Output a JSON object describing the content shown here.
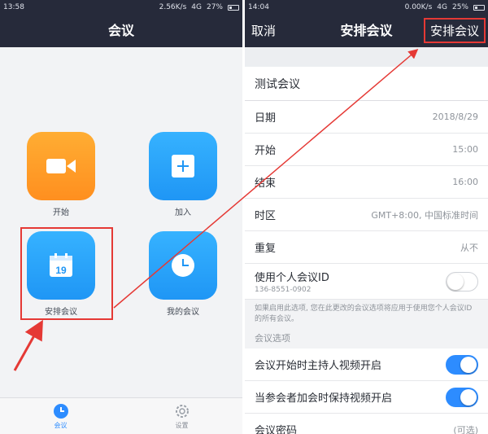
{
  "left": {
    "status": {
      "time": "13:58",
      "speed": "2.56K/s",
      "network": "4G",
      "battery": "27%"
    },
    "header": {
      "title": "会议"
    },
    "tiles": [
      {
        "label": "开始"
      },
      {
        "label": "加入"
      },
      {
        "label": "安排会议"
      },
      {
        "label": "我的会议"
      }
    ],
    "calendar_day": "19",
    "tabbar": [
      {
        "label": "会议"
      },
      {
        "label": "设置"
      }
    ]
  },
  "right": {
    "status": {
      "time": "14:04",
      "speed": "0.00K/s",
      "network": "4G",
      "battery": "25%"
    },
    "header": {
      "cancel": "取消",
      "title": "安排会议",
      "action": "安排会议"
    },
    "meeting_title": "测试会议",
    "rows": {
      "date": {
        "label": "日期",
        "value": "2018/8/29"
      },
      "start": {
        "label": "开始",
        "value": "15:00"
      },
      "end": {
        "label": "结束",
        "value": "16:00"
      },
      "timezone": {
        "label": "时区",
        "value": "GMT+8:00, 中国标准时间"
      },
      "repeat": {
        "label": "重复",
        "value": "从不"
      }
    },
    "pmi": {
      "label": "使用个人会议ID",
      "id": "136-8551-0902",
      "enabled": false
    },
    "pmi_note": "如果启用此选项, 您在此更改的会议选项将应用于使用您个人会议ID的所有会议。",
    "options_title": "会议选项",
    "options": [
      {
        "label": "会议开始时主持人视频开启",
        "enabled": true
      },
      {
        "label": "当参会者加会时保持视频开启",
        "enabled": true
      }
    ],
    "password": {
      "label": "会议密码",
      "value": "(可选)"
    }
  },
  "colors": {
    "header_bg": "#262a3a",
    "accent_blue": "#2d8cff",
    "orange": "#ff9a26",
    "highlight_red": "#e53935"
  }
}
